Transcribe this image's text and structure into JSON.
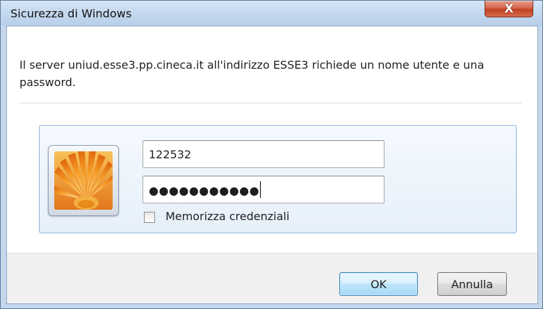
{
  "window": {
    "title": "Sicurezza di Windows",
    "close_label": "X"
  },
  "dialog": {
    "message": "Il server uniud.esse3.pp.cineca.it all'indirizzo ESSE3 richiede un nome utente e una password."
  },
  "credentials": {
    "username_value": "122532",
    "password_masked": "●●●●●●●●●●●",
    "remember_label": "Memorizza credenziali",
    "remember_checked": false
  },
  "buttons": {
    "ok_label": "OK",
    "cancel_label": "Annulla"
  },
  "colors": {
    "frame": "#c4d7ec",
    "tile_border": "#8fb5dc",
    "close_red": "#c1401f",
    "default_button_border": "#3c7fb1"
  },
  "icons": {
    "avatar": "orange-flower-icon",
    "close": "close-icon"
  }
}
